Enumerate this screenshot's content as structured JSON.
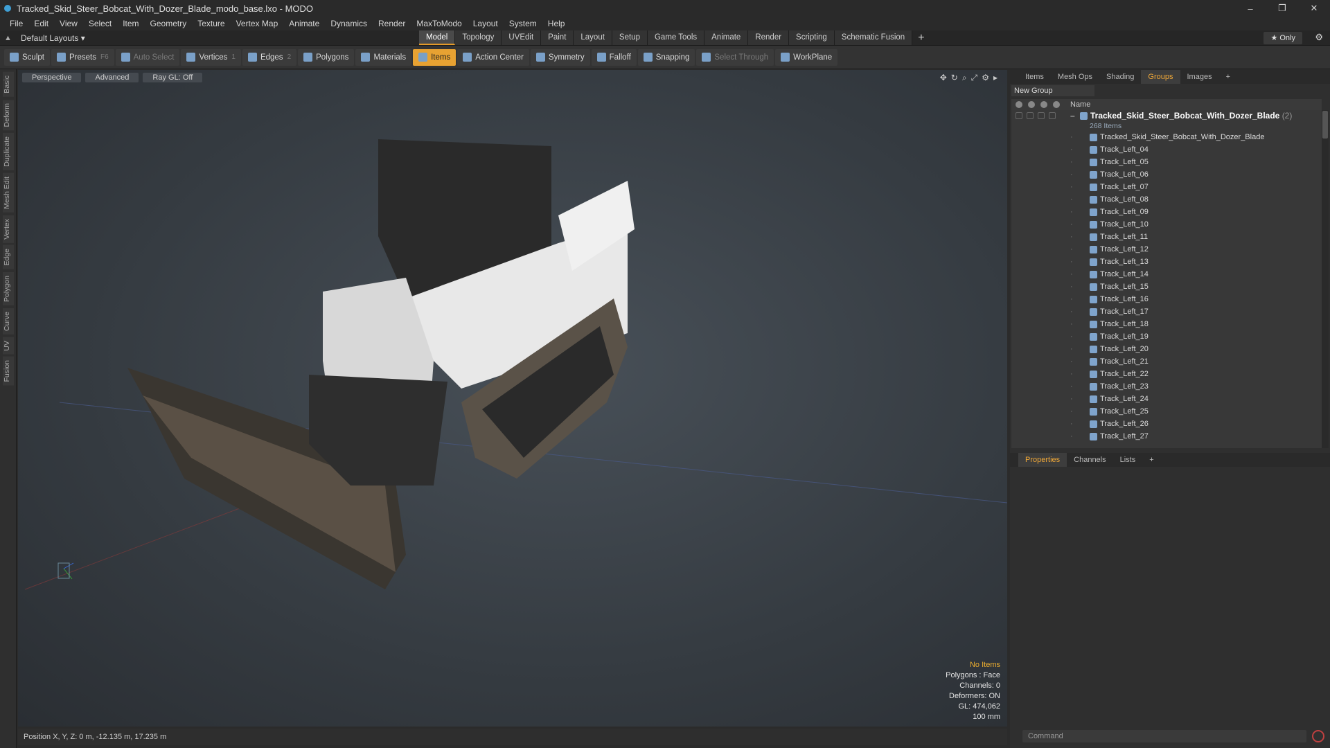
{
  "window": {
    "title": "Tracked_Skid_Steer_Bobcat_With_Dozer_Blade_modo_base.lxo - MODO",
    "controls": [
      "–",
      "❐",
      "✕"
    ]
  },
  "menu": [
    "File",
    "Edit",
    "View",
    "Select",
    "Item",
    "Geometry",
    "Texture",
    "Vertex Map",
    "Animate",
    "Dynamics",
    "Render",
    "MaxToModo",
    "Layout",
    "System",
    "Help"
  ],
  "layout": {
    "label": "Default Layouts ▾"
  },
  "modes": [
    "Model",
    "Topology",
    "UVEdit",
    "Paint",
    "Layout",
    "Setup",
    "Game Tools",
    "Animate",
    "Render",
    "Scripting",
    "Schematic Fusion"
  ],
  "modes_active": "Model",
  "only_label": "★ Only",
  "toolbar": [
    {
      "label": "Sculpt",
      "state": "normal"
    },
    {
      "label": "Presets",
      "key": "F6",
      "state": "normal"
    },
    {
      "label": "Auto Select",
      "state": "dim"
    },
    {
      "label": "Vertices",
      "key": "1",
      "state": "normal"
    },
    {
      "label": "Edges",
      "key": "2",
      "state": "normal"
    },
    {
      "label": "Polygons",
      "state": "normal"
    },
    {
      "label": "Materials",
      "state": "normal"
    },
    {
      "label": "Items",
      "state": "active"
    },
    {
      "label": "Action Center",
      "state": "normal"
    },
    {
      "label": "Symmetry",
      "state": "normal"
    },
    {
      "label": "Falloff",
      "state": "normal"
    },
    {
      "label": "Snapping",
      "state": "normal"
    },
    {
      "label": "Select Through",
      "state": "dim"
    },
    {
      "label": "WorkPlane",
      "state": "normal"
    }
  ],
  "left_tabs": [
    "Basic",
    "Deform",
    "Duplicate",
    "Mesh Edit",
    "Vertex",
    "Edge",
    "Polygon",
    "Curve",
    "UV",
    "Fusion"
  ],
  "viewport": {
    "view": "Perspective",
    "shading": "Advanced",
    "raygl": "Ray GL: Off",
    "info": {
      "selection": "No Items",
      "polygons": "Polygons : Face",
      "channels": "Channels: 0",
      "deformers": "Deformers: ON",
      "gl": "GL: 474,062",
      "scale": "100 mm"
    }
  },
  "status": {
    "position": "Position X, Y, Z:  0 m, -12.135 m, 17.235 m"
  },
  "right_panel": {
    "tabs": [
      "Items",
      "Mesh Ops",
      "Shading",
      "Groups",
      "Images",
      "+"
    ],
    "active_tab": "Groups",
    "new_group": "New Group",
    "name_col": "Name",
    "root": {
      "name": "Tracked_Skid_Steer_Bobcat_With_Dozer_Blade",
      "count": "(2)",
      "sub": "268 Items"
    },
    "items": [
      "Tracked_Skid_Steer_Bobcat_With_Dozer_Blade",
      "Track_Left_04",
      "Track_Left_05",
      "Track_Left_06",
      "Track_Left_07",
      "Track_Left_08",
      "Track_Left_09",
      "Track_Left_10",
      "Track_Left_11",
      "Track_Left_12",
      "Track_Left_13",
      "Track_Left_14",
      "Track_Left_15",
      "Track_Left_16",
      "Track_Left_17",
      "Track_Left_18",
      "Track_Left_19",
      "Track_Left_20",
      "Track_Left_21",
      "Track_Left_22",
      "Track_Left_23",
      "Track_Left_24",
      "Track_Left_25",
      "Track_Left_26",
      "Track_Left_27"
    ],
    "bottom_tabs": [
      "Properties",
      "Channels",
      "Lists",
      "+"
    ],
    "bottom_active": "Properties",
    "command_placeholder": "Command"
  }
}
